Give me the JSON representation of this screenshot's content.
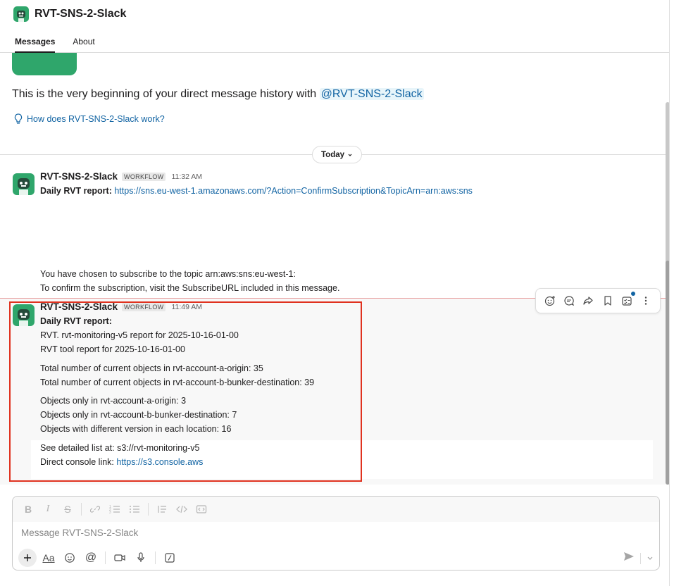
{
  "header": {
    "title": "RVT-SNS-2-Slack",
    "tabs": [
      {
        "label": "Messages",
        "active": true
      },
      {
        "label": "About",
        "active": false
      }
    ]
  },
  "intro": {
    "text": "This is the very beginning of your direct message history with ",
    "mention": "@RVT-SNS-2-Slack",
    "help_link": "How does RVT-SNS-2-Slack work?"
  },
  "day_divider": {
    "label": "Today"
  },
  "messages": [
    {
      "sender": "RVT-SNS-2-Slack",
      "badge": "WORKFLOW",
      "time": "11:32 AM",
      "prefix": "Daily RVT report:",
      "link": "https://sns.eu-west-1.amazonaws.com/?Action=ConfirmSubscription&TopicArn=arn:aws:sns",
      "lines": [
        "You have chosen to subscribe to the topic arn:aws:sns:eu-west-1:",
        "To confirm the subscription, visit the SubscribeURL included in this message."
      ]
    },
    {
      "sender": "RVT-SNS-2-Slack",
      "badge": "WORKFLOW",
      "time": "11:49 AM",
      "title": "Daily RVT report:",
      "report_line1": "RVT. rvt-monitoring-v5 report for 2025-10-16-01-00",
      "report_line2": "RVT tool report for 2025-10-16-01-00",
      "total_a": "Total number of current objects in rvt-account-a-origin: 35",
      "total_b": "Total number of current objects in rvt-account-b-bunker-destination: 39",
      "only_a": "Objects only in rvt-account-a-origin: 3",
      "only_b": "Objects only in rvt-account-b-bunker-destination: 7",
      "diff": "Objects with different version in each location: 16",
      "detail_label": "See detailed list at: s3://rvt-monitoring-v5",
      "console_label": "Direct console link: ",
      "console_link": "https://s3.console.aws"
    }
  ],
  "composer": {
    "placeholder": "Message RVT-SNS-2-Slack",
    "format_label": "Aa"
  },
  "colors": {
    "brand_green": "#2fa66b",
    "link": "#1264a3",
    "highlight_border": "#e0321f"
  }
}
